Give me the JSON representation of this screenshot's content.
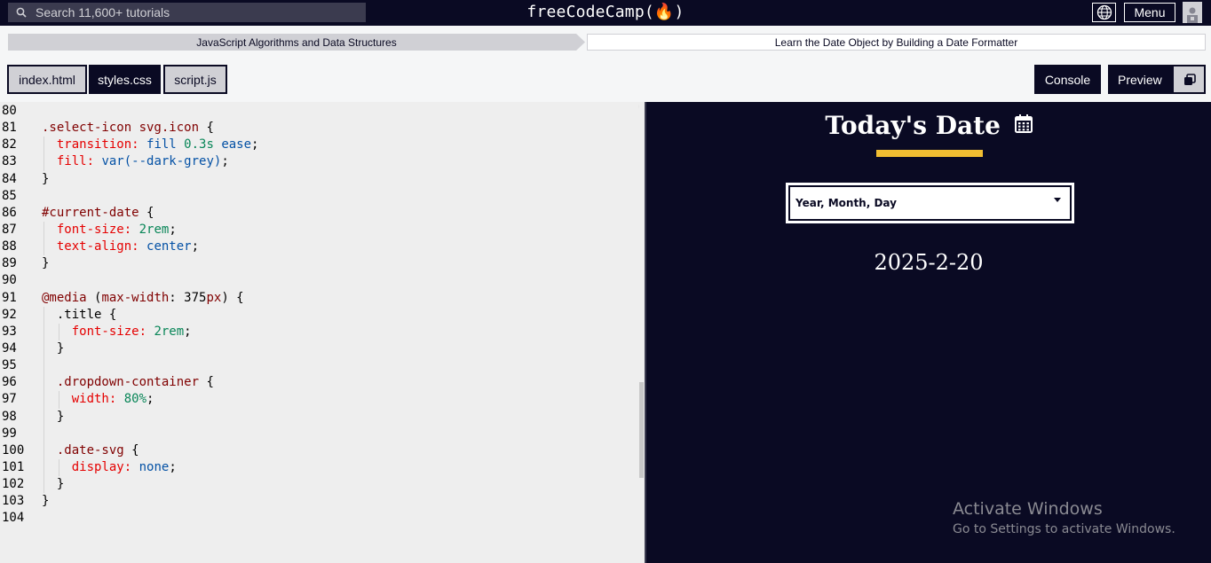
{
  "header": {
    "search_placeholder": "Search 11,600+ tutorials",
    "logo": "freeCodeCamp(🔥)",
    "menu_label": "Menu",
    "icons": [
      "search-icon",
      "globe-icon",
      "avatar-icon"
    ]
  },
  "breadcrumb": {
    "superblock": "JavaScript Algorithms and Data Structures",
    "block": "Learn the Date Object by Building a Date Formatter"
  },
  "tabs": {
    "files": [
      {
        "label": "index.html",
        "active": false
      },
      {
        "label": "styles.css",
        "active": true
      },
      {
        "label": "script.js",
        "active": false
      }
    ],
    "console_label": "Console",
    "preview_label": "Preview"
  },
  "editor": {
    "lines": [
      {
        "n": "80",
        "indent": 0,
        "tokens": []
      },
      {
        "n": "81",
        "indent": 0,
        "tokens": [
          [
            "sel",
            ".select-icon svg.icon"
          ],
          [
            "punc",
            " {"
          ]
        ]
      },
      {
        "n": "82",
        "indent": 1,
        "tokens": [
          [
            "prop",
            "transition:"
          ],
          [
            "punc",
            " "
          ],
          [
            "val",
            "fill"
          ],
          [
            "punc",
            " "
          ],
          [
            "num",
            "0.3s"
          ],
          [
            "punc",
            " "
          ],
          [
            "val",
            "ease"
          ],
          [
            "punc",
            ";"
          ]
        ]
      },
      {
        "n": "83",
        "indent": 1,
        "tokens": [
          [
            "prop",
            "fill:"
          ],
          [
            "punc",
            " "
          ],
          [
            "val",
            "var(--dark-grey)"
          ],
          [
            "punc",
            ";"
          ]
        ]
      },
      {
        "n": "84",
        "indent": 0,
        "tokens": [
          [
            "punc",
            "}"
          ]
        ]
      },
      {
        "n": "85",
        "indent": 0,
        "tokens": []
      },
      {
        "n": "86",
        "indent": 0,
        "tokens": [
          [
            "sel",
            "#current-date"
          ],
          [
            "punc",
            " {"
          ]
        ]
      },
      {
        "n": "87",
        "indent": 1,
        "tokens": [
          [
            "prop",
            "font-size:"
          ],
          [
            "punc",
            " "
          ],
          [
            "num",
            "2rem"
          ],
          [
            "punc",
            ";"
          ]
        ]
      },
      {
        "n": "88",
        "indent": 1,
        "tokens": [
          [
            "prop",
            "text-align:"
          ],
          [
            "punc",
            " "
          ],
          [
            "val",
            "center"
          ],
          [
            "punc",
            ";"
          ]
        ]
      },
      {
        "n": "89",
        "indent": 0,
        "tokens": [
          [
            "punc",
            "}"
          ]
        ]
      },
      {
        "n": "90",
        "indent": 0,
        "tokens": []
      },
      {
        "n": "91",
        "indent": 0,
        "tokens": [
          [
            "sel",
            "@media"
          ],
          [
            "punc",
            " ("
          ],
          [
            "sel",
            "max-width"
          ],
          [
            "punc",
            ": "
          ],
          [
            "punc",
            "375"
          ],
          [
            "sel",
            "px"
          ],
          [
            "punc",
            ") {"
          ]
        ]
      },
      {
        "n": "92",
        "indent": 1,
        "tokens": [
          [
            "punc",
            ".title {"
          ]
        ]
      },
      {
        "n": "93",
        "indent": 2,
        "tokens": [
          [
            "prop",
            "font-size:"
          ],
          [
            "punc",
            " "
          ],
          [
            "num",
            "2rem"
          ],
          [
            "punc",
            ";"
          ]
        ]
      },
      {
        "n": "94",
        "indent": 1,
        "tokens": [
          [
            "punc",
            "}"
          ]
        ]
      },
      {
        "n": "95",
        "indent": 1,
        "tokens": []
      },
      {
        "n": "96",
        "indent": 1,
        "tokens": [
          [
            "sel",
            ".dropdown-container"
          ],
          [
            "punc",
            " {"
          ]
        ]
      },
      {
        "n": "97",
        "indent": 2,
        "tokens": [
          [
            "prop",
            "width:"
          ],
          [
            "punc",
            " "
          ],
          [
            "num",
            "80%"
          ],
          [
            "punc",
            ";"
          ]
        ]
      },
      {
        "n": "98",
        "indent": 1,
        "tokens": [
          [
            "punc",
            "}"
          ]
        ]
      },
      {
        "n": "99",
        "indent": 1,
        "tokens": []
      },
      {
        "n": "100",
        "indent": 1,
        "tokens": [
          [
            "sel",
            ".date-svg"
          ],
          [
            "punc",
            " {"
          ]
        ]
      },
      {
        "n": "101",
        "indent": 2,
        "tokens": [
          [
            "prop",
            "display:"
          ],
          [
            "punc",
            " "
          ],
          [
            "val",
            "none"
          ],
          [
            "punc",
            ";"
          ]
        ]
      },
      {
        "n": "102",
        "indent": 1,
        "tokens": [
          [
            "punc",
            "}"
          ]
        ]
      },
      {
        "n": "103",
        "indent": 0,
        "tokens": [
          [
            "punc",
            "}"
          ]
        ]
      },
      {
        "n": "104",
        "indent": 0,
        "tokens": []
      }
    ]
  },
  "preview": {
    "title": "Today's Date",
    "title_icon": "calendar-icon",
    "dropdown_selected": "Year, Month, Day",
    "current_date": "2025-2-20"
  },
  "watermark": {
    "line1": "Activate Windows",
    "line2": "Go to Settings to activate Windows."
  },
  "colors": {
    "nav_bg": "#0a0a23",
    "accent_yellow": "#f1be32",
    "editor_bg": "#eeeeee",
    "selector": "#800000",
    "property": "#e50000",
    "value": "#0451a5",
    "number": "#098658"
  }
}
